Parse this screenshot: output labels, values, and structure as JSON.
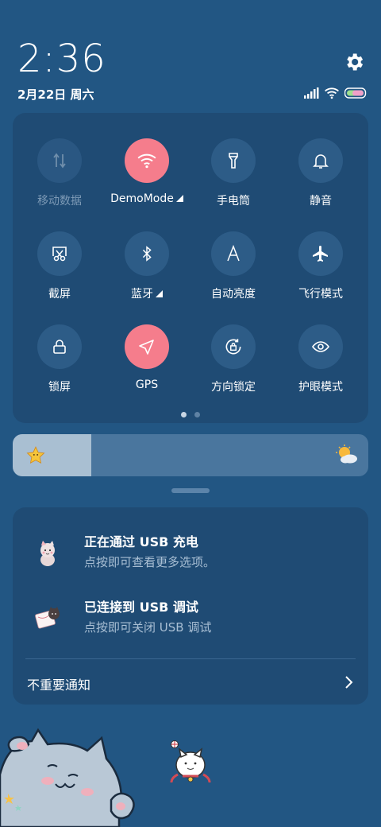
{
  "status": {
    "time": "2:36",
    "date": "2月22日 周六"
  },
  "quick_settings": {
    "tiles": [
      {
        "label": "移动数据",
        "icon": "mobile-data-icon",
        "state": "disabled"
      },
      {
        "label": "DemoMode",
        "icon": "wifi-icon",
        "state": "active"
      },
      {
        "label": "手电筒",
        "icon": "flashlight-icon",
        "state": "off"
      },
      {
        "label": "静音",
        "icon": "bell-icon",
        "state": "off"
      },
      {
        "label": "截屏",
        "icon": "screenshot-icon",
        "state": "off"
      },
      {
        "label": "蓝牙",
        "icon": "bluetooth-icon",
        "state": "off"
      },
      {
        "label": "自动亮度",
        "icon": "auto-brightness-icon",
        "state": "off"
      },
      {
        "label": "飞行模式",
        "icon": "airplane-icon",
        "state": "off"
      },
      {
        "label": "锁屏",
        "icon": "lock-icon",
        "state": "off"
      },
      {
        "label": "GPS",
        "icon": "location-icon",
        "state": "active"
      },
      {
        "label": "方向锁定",
        "icon": "rotation-lock-icon",
        "state": "off"
      },
      {
        "label": "护眼模式",
        "icon": "eye-icon",
        "state": "off"
      }
    ],
    "page_count": 2,
    "current_page": 1
  },
  "brightness": {
    "level": 0.22
  },
  "notifications": [
    {
      "title": "正在通过 USB 充电",
      "subtitle": "点按即可查看更多选项。"
    },
    {
      "title": "已连接到 USB 调试",
      "subtitle": "点按即可关闭 USB 调试"
    }
  ],
  "unimportant_label": "不重要通知",
  "colors": {
    "background": "#225683",
    "panel": "#1f4b74",
    "active_tile": "#f57d8c"
  }
}
